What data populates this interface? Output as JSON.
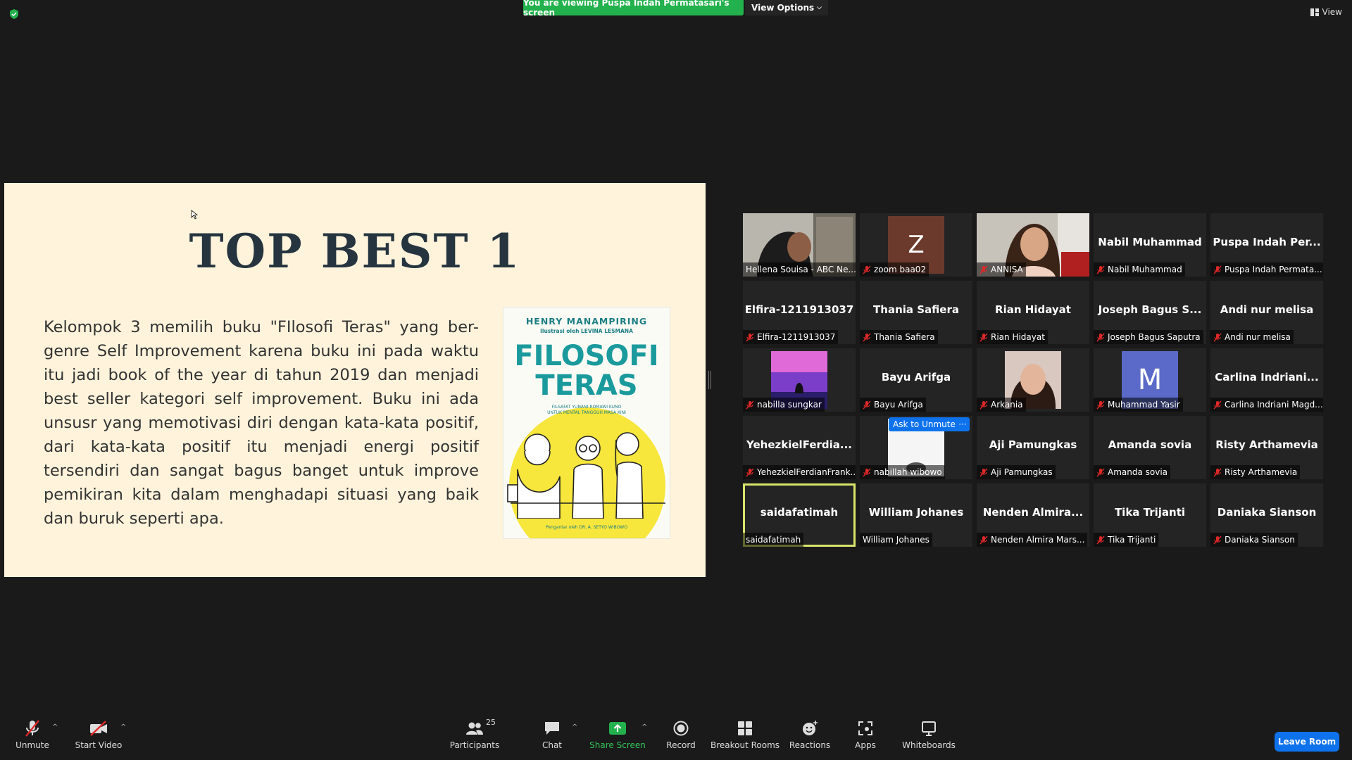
{
  "top": {
    "viewing_banner": "You are viewing Puspa Indah Permatasari's screen",
    "view_options": "View Options",
    "view": "View"
  },
  "slide": {
    "title": "TOP BEST 1",
    "body": "Kelompok 3 memilih buku \"FIlosofi Teras\" yang ber-genre Self Improvement karena buku ini pada waktu itu jadi book of the year di tahun 2019 dan menjadi best seller kategori self improvement. Buku ini ada unsusr yang memotivasi diri dengan kata-kata positif, dari kata-kata positif itu menjadi energi positif tersendiri dan sangat bagus banget untuk improve pemikiran kita dalam menghadapi situasi yang baik dan buruk seperti apa.",
    "book": {
      "author": "HENRY MANAMPIRING",
      "illustrator": "Ilustrasi oleh LEVINA LESMANA",
      "title_line1": "FILOSOFI",
      "title_line2": "TERAS",
      "subtitle_line1": "FILSAFAT YUNANI-ROMAWI KUNO",
      "subtitle_line2": "UNTUK MENTAL TANGGUH MASA KINI",
      "footer": "Pengantar oleh DR. A. SETYO WIBOWO"
    }
  },
  "participants": [
    {
      "name": "",
      "label": "Hellena Souisa - ABC Ne...",
      "muted": false,
      "kind": "video1"
    },
    {
      "name": "",
      "label": "zoom baa02",
      "muted": true,
      "kind": "z"
    },
    {
      "name": "",
      "label": "ANNISA",
      "muted": true,
      "kind": "video2"
    },
    {
      "name": "Nabil Muhammad",
      "label": "Nabil Muhammad",
      "muted": true
    },
    {
      "name": "Puspa Indah Per...",
      "label": "Puspa Indah Permata...",
      "muted": true
    },
    {
      "name": "Elfira-1211913037",
      "label": "Elfira-1211913037",
      "muted": true
    },
    {
      "name": "Thania Safiera",
      "label": "Thania Safiera",
      "muted": true
    },
    {
      "name": "Rian Hidayat",
      "label": "Rian Hidayat",
      "muted": true
    },
    {
      "name": "Joseph Bagus S...",
      "label": "Joseph Bagus Saputra",
      "muted": true
    },
    {
      "name": "Andi nur melisa",
      "label": "Andi nur melisa",
      "muted": true
    },
    {
      "name": "",
      "label": "nabilla sungkar",
      "muted": true,
      "kind": "thumb-purple"
    },
    {
      "name": "Bayu Arifga",
      "label": "Bayu Arifga",
      "muted": true
    },
    {
      "name": "",
      "label": "Arkania",
      "muted": true,
      "kind": "thumb-face"
    },
    {
      "name": "",
      "label": "Muhammad Yasir",
      "muted": true,
      "kind": "letter",
      "letter": "M"
    },
    {
      "name": "Carlina  Indriani...",
      "label": "Carlina Indriani Magd...",
      "muted": true
    },
    {
      "name": "YehezkielFerdia...",
      "label": "YehezkielFerdianFrank...",
      "muted": true
    },
    {
      "name": "",
      "label": "nabillah wibowo",
      "muted": true,
      "kind": "thumb-white"
    },
    {
      "name": "Aji Pamungkas",
      "label": "Aji Pamungkas",
      "muted": true
    },
    {
      "name": "Amanda sovia",
      "label": "Amanda sovia",
      "muted": true
    },
    {
      "name": "Risty Arthamevia",
      "label": "Risty Arthamevia",
      "muted": true
    },
    {
      "name": "saidafatimah",
      "label": "saidafatimah",
      "muted": false,
      "active": true
    },
    {
      "name": "William Johanes",
      "label": "William Johanes",
      "muted": false
    },
    {
      "name": "Nenden  Almira...",
      "label": "Nenden Almira Mars...",
      "muted": true
    },
    {
      "name": "Tika Trijanti",
      "label": "Tika Trijanti",
      "muted": true
    },
    {
      "name": "Daniaka Sianson",
      "label": "Daniaka Sianson",
      "muted": true
    }
  ],
  "hover_actions": {
    "ask_unmute": "Ask to Unmute",
    "more": "···"
  },
  "toolbar": {
    "unmute": "Unmute",
    "start_video": "Start Video",
    "participants": "Participants",
    "participants_count": "25",
    "chat": "Chat",
    "share_screen": "Share Screen",
    "record": "Record",
    "breakout_rooms": "Breakout Rooms",
    "reactions": "Reactions",
    "apps": "Apps",
    "whiteboards": "Whiteboards",
    "leave_room": "Leave Room"
  }
}
